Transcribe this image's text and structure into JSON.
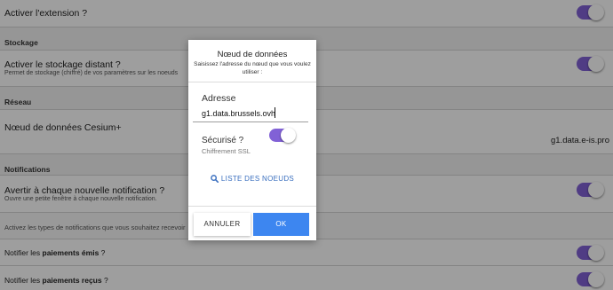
{
  "settings": {
    "activate_extension": "Activer l'extension ?",
    "storage_section": "Stockage",
    "remote_storage_title": "Activer le stockage distant ?",
    "remote_storage_sub": "Permet de stockage (chiffré) de vos paramètres sur les noeuds",
    "network_section": "Réseau",
    "cesium_node_title": "Nœud de données Cesium+",
    "cesium_node_value": "g1.data.e-is.pro",
    "notifications_section": "Notifications",
    "notify_new_title": "Avertir à chaque nouvelle notification ?",
    "notify_new_sub": "Ouvre une petite fenêtre à chaque nouvelle notification.",
    "notification_types_hint": "Activez les types de notifications que vous souhaitez recevoir",
    "notify_sent_prefix": "Notifier les ",
    "notify_sent_bold": "paiements émis",
    "notify_sent_suffix": " ?",
    "notify_received_prefix": "Notifier les ",
    "notify_received_bold": "paiements reçus",
    "notify_received_suffix": " ?"
  },
  "dialog": {
    "title": "Nœud de données",
    "message": "Saisissez l'adresse du nœud que vous voulez utiliser :",
    "address_label": "Adresse",
    "address_value": "g1.data.brussels.ovh",
    "secure_label": "Sécurisé ?",
    "secure_sub": "Chiffrement SSL",
    "secure_on": true,
    "list_button": "LISTE DES NOEUDS",
    "cancel_button": "ANNULER",
    "ok_button": "OK"
  },
  "colors": {
    "toggle_on": "#8161d6",
    "ok_button": "#3d86f0",
    "link": "#3a6fbf"
  }
}
